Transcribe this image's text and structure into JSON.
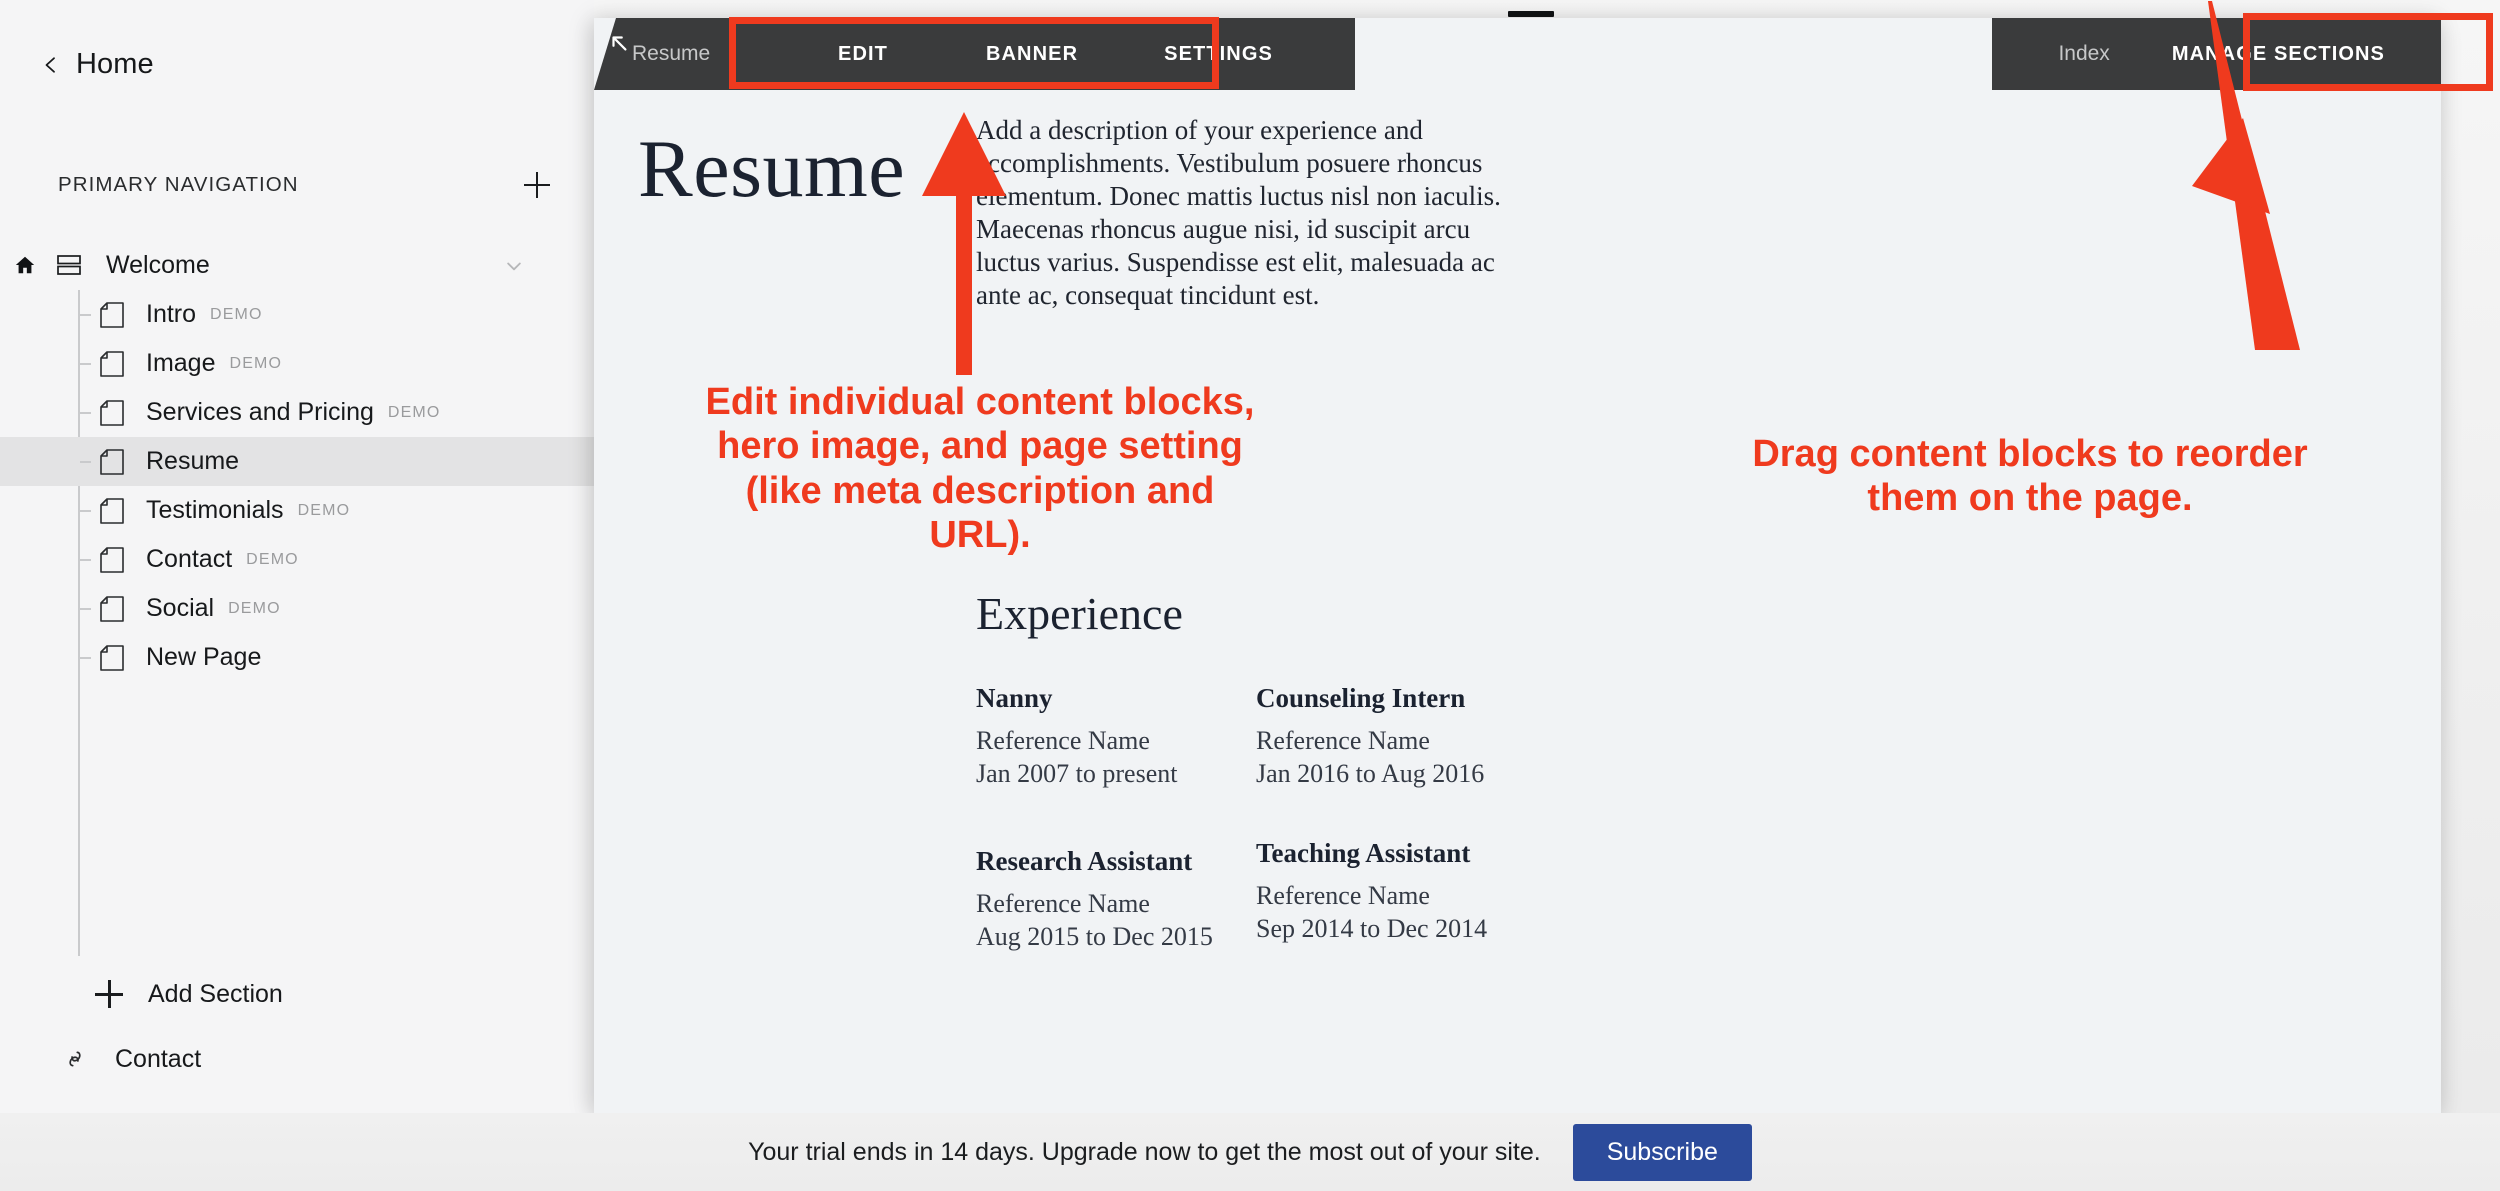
{
  "sidebar": {
    "back": {
      "label": "Home",
      "icon": "chevron-left-icon"
    },
    "section_title": "PRIMARY NAVIGATION",
    "add_icon": "plus-icon",
    "index": {
      "label": "Welcome",
      "home_icon": "home-icon",
      "stack_icon": "index-stack-icon",
      "chevron_icon": "chevron-down-icon"
    },
    "pages": [
      {
        "label": "Intro",
        "tag": "DEMO",
        "active": false
      },
      {
        "label": "Image",
        "tag": "DEMO",
        "active": false
      },
      {
        "label": "Services and Pricing",
        "tag": "DEMO",
        "active": false
      },
      {
        "label": "Resume",
        "tag": "",
        "active": true
      },
      {
        "label": "Testimonials",
        "tag": "DEMO",
        "active": false
      },
      {
        "label": "Contact",
        "tag": "DEMO",
        "active": false
      },
      {
        "label": "Social",
        "tag": "DEMO",
        "active": false
      },
      {
        "label": "New Page",
        "tag": "",
        "active": false
      }
    ],
    "add_section": {
      "label": "Add Section",
      "icon": "plus-icon"
    },
    "external_link": {
      "label": "Contact",
      "icon": "link-icon"
    }
  },
  "toolbar": {
    "back_icon": "back-arrow-icon",
    "page_tab": "Resume",
    "edit": "EDIT",
    "banner": "BANNER",
    "settings": "SETTINGS",
    "index_label": "Index",
    "manage_sections": "MANAGE SECTIONS"
  },
  "preview": {
    "title": "Resume",
    "body": "Add a description of your experience and accomplishments. Vestibulum posuere rhoncus elementum. Donec mattis luctus nisl non iaculis. Maecenas rhoncus augue nisi, id suscipit arcu luctus varius. Suspendisse est elit, malesuada ac ante ac, consequat tincidunt est.",
    "experience_heading": "Experience",
    "jobs_left": [
      {
        "title": "Nanny",
        "reference": "Reference Name",
        "dates": "Jan 2007 to present"
      },
      {
        "title": "Research Assistant",
        "reference": "Reference Name",
        "dates": "Aug 2015 to Dec 2015"
      }
    ],
    "jobs_right": [
      {
        "title": "Counseling Intern",
        "reference": "Reference Name",
        "dates": "Jan 2016 to Aug 2016"
      },
      {
        "title": "Teaching Assistant",
        "reference": "Reference Name",
        "dates": "Sep 2014 to Dec 2014"
      }
    ]
  },
  "annotations": {
    "color": "#ef3a1e",
    "left_text": "Edit individual content blocks, hero image, and page setting (like meta description and URL).",
    "right_text": "Drag content blocks to reorder them on the page."
  },
  "trial": {
    "message": "Your trial ends in 14 days. Upgrade now to get the most out of your site.",
    "button": "Subscribe",
    "button_color": "#2c4b9b"
  }
}
